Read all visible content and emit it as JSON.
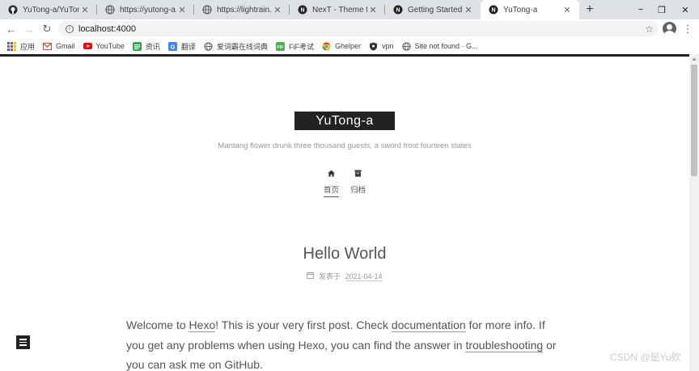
{
  "tabs": [
    {
      "title": "YuTong-a/YuTong-",
      "icon": "github-icon",
      "active": false
    },
    {
      "title": "https://yutong-a.gi",
      "icon": "globe-icon",
      "active": false
    },
    {
      "title": "https://lightrain.to",
      "icon": "globe-icon",
      "active": false
    },
    {
      "title": "NexT - Theme for H",
      "icon": "next-icon",
      "active": false
    },
    {
      "title": "Getting Started | N",
      "icon": "next-icon",
      "active": false
    },
    {
      "title": "YuTong-a",
      "icon": "next-icon",
      "active": true
    }
  ],
  "new_tab_label": "+",
  "window_controls": {
    "minimize": "−",
    "maximize": "❐",
    "close": "✕"
  },
  "toolbar": {
    "back": "←",
    "forward": "→",
    "reload": "↻",
    "url": "localhost:4000",
    "star": "☆",
    "menu": "⋮"
  },
  "bookmarks": [
    {
      "label": "应用",
      "icon": "apps-icon"
    },
    {
      "label": "Gmail",
      "icon": "gmail-icon"
    },
    {
      "label": "YouTube",
      "icon": "youtube-icon"
    },
    {
      "label": "资讯",
      "icon": "news-icon"
    },
    {
      "label": "翻译",
      "icon": "translate-icon"
    },
    {
      "label": "爱词霸在线词典",
      "icon": "globe-icon"
    },
    {
      "label": "FiF考试",
      "icon": "fif-icon"
    },
    {
      "label": "Ghelper",
      "icon": "chrome-icon"
    },
    {
      "label": "vpn",
      "icon": "vpn-icon"
    },
    {
      "label": "Site not found · G...",
      "icon": "globe-icon"
    }
  ],
  "site": {
    "brand": "YuTong-a",
    "subtitle": "Mantang flower drunk three thousand guests, a sword frost fourteen states",
    "menu": [
      {
        "label": "首页",
        "icon": "home-icon",
        "current": true
      },
      {
        "label": "归档",
        "icon": "archive-icon",
        "current": false
      }
    ]
  },
  "post": {
    "title": "Hello World",
    "meta_prefix": "发表于",
    "date": "2021-04-14",
    "body": {
      "t1": "Welcome to ",
      "l1": "Hexo",
      "t2": "! This is your very first post. Check ",
      "l2": "documentation",
      "t3": " for more info. If you get any problems when using Hexo, you can find the answer in ",
      "l3": "troubleshooting",
      "t4": " or you can ask me on ",
      "l4": "GitHub",
      "t5": "."
    }
  },
  "watermark": "CSDN @是Yu欸",
  "colors": {
    "tab_strip": "#dee1e6",
    "brand_bg": "#222222",
    "text": "#555555",
    "muted": "#999999"
  }
}
